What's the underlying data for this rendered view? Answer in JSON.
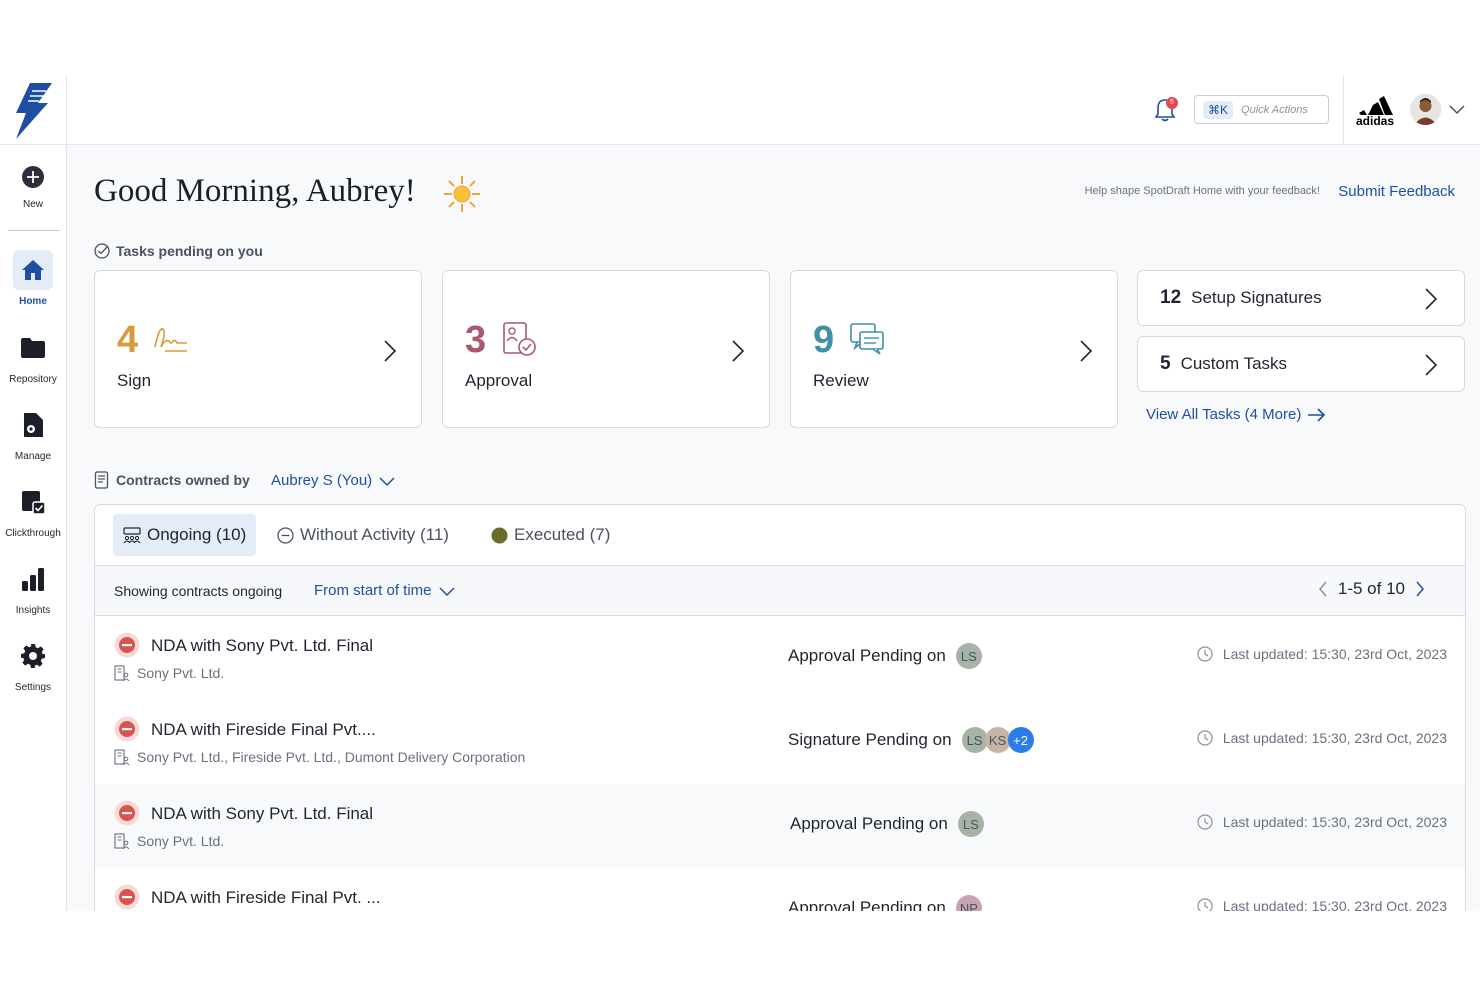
{
  "sidebar": {
    "items": [
      {
        "label": "New"
      },
      {
        "label": "Home"
      },
      {
        "label": "Repository"
      },
      {
        "label": "Manage"
      },
      {
        "label": "Clickthrough"
      },
      {
        "label": "Insights"
      },
      {
        "label": "Settings"
      }
    ]
  },
  "topbar": {
    "notification_count": "5",
    "shortcut": "⌘K",
    "quick_actions_label": "Quick Actions",
    "org_logo": "adidas-logo"
  },
  "greeting": "Good Morning, Aubrey!",
  "feedback": {
    "help_text": "Help shape SpotDraft Home with your feedback!",
    "link_label": "Submit Feedback"
  },
  "tasks": {
    "section_label": "Tasks pending on you",
    "cards": [
      {
        "count": "4",
        "label": "Sign",
        "color": "#d99a3c",
        "icon": "signature-icon"
      },
      {
        "count": "3",
        "label": "Approval",
        "color": "#a8596c",
        "icon": "approval-icon"
      },
      {
        "count": "9",
        "label": "Review",
        "color": "#3f8fa6",
        "icon": "review-icon"
      }
    ],
    "mini_cards": [
      {
        "count": "12",
        "label": "Setup Signatures"
      },
      {
        "count": "5",
        "label": "Custom Tasks"
      }
    ],
    "view_all_label": "View All Tasks (4 More)"
  },
  "contracts": {
    "section_label": "Contracts owned by",
    "owner": "Aubrey S (You)",
    "tabs": [
      {
        "label": "Ongoing (10)"
      },
      {
        "label": "Without Activity (11)"
      },
      {
        "label": "Executed (7)"
      }
    ],
    "showing_label": "Showing contracts ongoing",
    "period": "From start of time",
    "pagination": "1-5 of 10",
    "rows": [
      {
        "title": "NDA with Sony Pvt. Ltd. Final",
        "parties": "Sony Pvt. Ltd.",
        "pending": "Approval Pending on",
        "assignees": [
          "LS"
        ],
        "updated": "Last updated: 15:30, 23rd Oct, 2023"
      },
      {
        "title": "NDA with Fireside Final Pvt....",
        "parties": "Sony Pvt. Ltd., Fireside Pvt. Ltd., Dumont Delivery Corporation",
        "pending": "Signature Pending on",
        "assignees": [
          "LS",
          "KS",
          "+2"
        ],
        "updated": "Last updated: 15:30, 23rd Oct, 2023"
      },
      {
        "title": "NDA with Sony Pvt. Ltd. Final",
        "parties": "Sony Pvt. Ltd.",
        "pending": "Approval Pending on",
        "assignees": [
          "LS"
        ],
        "updated": "Last updated: 15:30, 23rd Oct, 2023"
      },
      {
        "title": "NDA with Fireside Final Pvt. ...",
        "parties": "",
        "pending": "Approval Pending on",
        "assignees": [
          "NP"
        ],
        "updated": "Last updated: 15:30, 23rd Oct, 2023"
      }
    ]
  },
  "colors": {
    "accent": "#1f4fa3",
    "active_bg": "#e4ecf8",
    "executed_dot": "#6b6b2a",
    "status_red": "#d9534f"
  }
}
